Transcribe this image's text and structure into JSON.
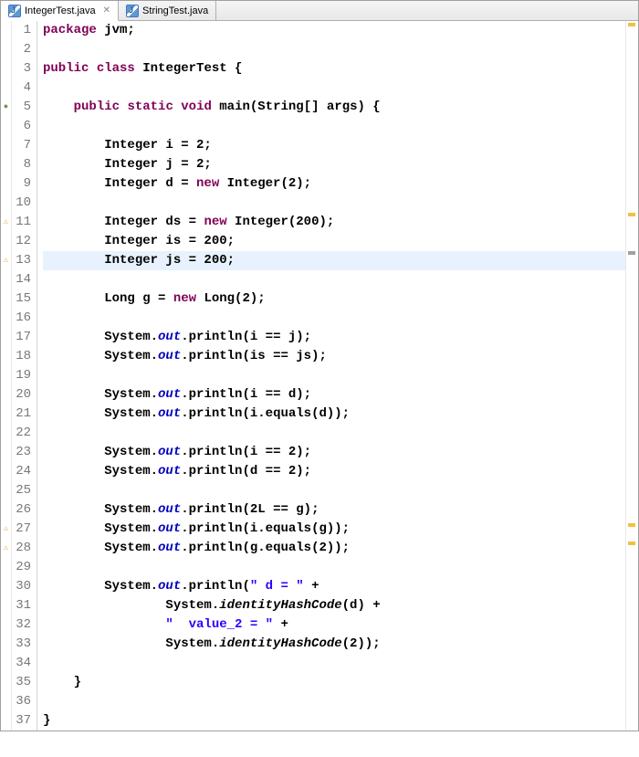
{
  "tabs": [
    {
      "label": "IntegerTest.java",
      "active": true
    },
    {
      "label": "StringTest.java",
      "active": false
    }
  ],
  "highlightedLine": 13,
  "markers": {
    "5": "override",
    "11": "warn",
    "13": "warn",
    "27": "warn",
    "28": "warn"
  },
  "code": [
    {
      "n": 1,
      "t": [
        [
          "kw",
          "package"
        ],
        [
          "plain",
          " jvm;"
        ]
      ]
    },
    {
      "n": 2,
      "t": []
    },
    {
      "n": 3,
      "t": [
        [
          "kw",
          "public"
        ],
        [
          "plain",
          " "
        ],
        [
          "kw",
          "class"
        ],
        [
          "plain",
          " IntegerTest {"
        ]
      ]
    },
    {
      "n": 4,
      "t": []
    },
    {
      "n": 5,
      "t": [
        [
          "plain",
          "    "
        ],
        [
          "kw",
          "public"
        ],
        [
          "plain",
          " "
        ],
        [
          "kw",
          "static"
        ],
        [
          "plain",
          " "
        ],
        [
          "kw",
          "void"
        ],
        [
          "plain",
          " main(String[] args) {"
        ]
      ]
    },
    {
      "n": 6,
      "t": []
    },
    {
      "n": 7,
      "t": [
        [
          "plain",
          "        Integer i = 2;"
        ]
      ]
    },
    {
      "n": 8,
      "t": [
        [
          "plain",
          "        Integer j = 2;"
        ]
      ]
    },
    {
      "n": 9,
      "t": [
        [
          "plain",
          "        Integer d = "
        ],
        [
          "kw",
          "new"
        ],
        [
          "plain",
          " Integer(2);"
        ]
      ]
    },
    {
      "n": 10,
      "t": []
    },
    {
      "n": 11,
      "t": [
        [
          "plain",
          "        Integer ds = "
        ],
        [
          "kw",
          "new"
        ],
        [
          "plain",
          " Integer(200);"
        ]
      ]
    },
    {
      "n": 12,
      "t": [
        [
          "plain",
          "        Integer is = 200;"
        ]
      ]
    },
    {
      "n": 13,
      "t": [
        [
          "plain",
          "        Integer js = 200;"
        ]
      ]
    },
    {
      "n": 14,
      "t": []
    },
    {
      "n": 15,
      "t": [
        [
          "plain",
          "        Long g = "
        ],
        [
          "kw",
          "new"
        ],
        [
          "plain",
          " Long(2);"
        ]
      ]
    },
    {
      "n": 16,
      "t": []
    },
    {
      "n": 17,
      "t": [
        [
          "plain",
          "        System."
        ],
        [
          "field",
          "out"
        ],
        [
          "plain",
          ".println(i == j);"
        ]
      ]
    },
    {
      "n": 18,
      "t": [
        [
          "plain",
          "        System."
        ],
        [
          "field",
          "out"
        ],
        [
          "plain",
          ".println(is == js);"
        ]
      ]
    },
    {
      "n": 19,
      "t": []
    },
    {
      "n": 20,
      "t": [
        [
          "plain",
          "        System."
        ],
        [
          "field",
          "out"
        ],
        [
          "plain",
          ".println(i == d);"
        ]
      ]
    },
    {
      "n": 21,
      "t": [
        [
          "plain",
          "        System."
        ],
        [
          "field",
          "out"
        ],
        [
          "plain",
          ".println(i.equals(d));"
        ]
      ]
    },
    {
      "n": 22,
      "t": []
    },
    {
      "n": 23,
      "t": [
        [
          "plain",
          "        System."
        ],
        [
          "field",
          "out"
        ],
        [
          "plain",
          ".println(i == 2);"
        ]
      ]
    },
    {
      "n": 24,
      "t": [
        [
          "plain",
          "        System."
        ],
        [
          "field",
          "out"
        ],
        [
          "plain",
          ".println(d == 2);"
        ]
      ]
    },
    {
      "n": 25,
      "t": []
    },
    {
      "n": 26,
      "t": [
        [
          "plain",
          "        System."
        ],
        [
          "field",
          "out"
        ],
        [
          "plain",
          ".println(2L == g);"
        ]
      ]
    },
    {
      "n": 27,
      "t": [
        [
          "plain",
          "        System."
        ],
        [
          "field",
          "out"
        ],
        [
          "plain",
          ".println(i.equals(g));"
        ]
      ]
    },
    {
      "n": 28,
      "t": [
        [
          "plain",
          "        System."
        ],
        [
          "field",
          "out"
        ],
        [
          "plain",
          ".println(g.equals(2));"
        ]
      ]
    },
    {
      "n": 29,
      "t": []
    },
    {
      "n": 30,
      "t": [
        [
          "plain",
          "        System."
        ],
        [
          "field",
          "out"
        ],
        [
          "plain",
          ".println("
        ],
        [
          "str",
          "\" d = \""
        ],
        [
          "plain",
          " +"
        ]
      ]
    },
    {
      "n": 31,
      "t": [
        [
          "plain",
          "                System."
        ],
        [
          "plain",
          "identityHashCode"
        ],
        [
          "plain",
          "(d) +"
        ]
      ]
    },
    {
      "n": 32,
      "t": [
        [
          "plain",
          "                "
        ],
        [
          "str",
          "\"  value_2 = \""
        ],
        [
          "plain",
          " +"
        ]
      ]
    },
    {
      "n": 33,
      "t": [
        [
          "plain",
          "                System."
        ],
        [
          "plain",
          "identityHashCode"
        ],
        [
          "plain",
          "(2));"
        ]
      ]
    },
    {
      "n": 34,
      "t": []
    },
    {
      "n": 35,
      "t": [
        [
          "plain",
          "    }"
        ]
      ]
    },
    {
      "n": 36,
      "t": []
    },
    {
      "n": 37,
      "t": [
        [
          "plain",
          "}"
        ]
      ]
    }
  ],
  "identityHashCodeStyle": "italic"
}
